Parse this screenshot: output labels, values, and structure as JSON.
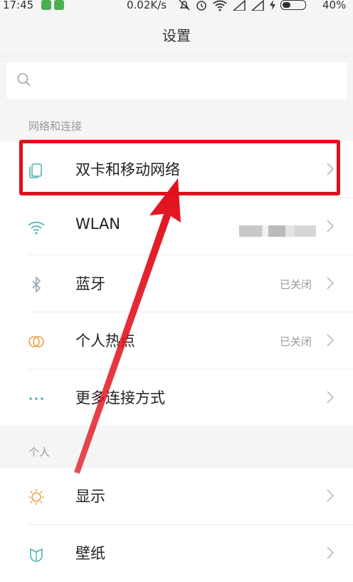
{
  "status_bar": {
    "time": "17:45",
    "speed": "0.02K/s",
    "battery": "40%",
    "battery_level": 0.4
  },
  "header": {
    "title": "设置"
  },
  "search": {
    "placeholder": ""
  },
  "network_section": {
    "heading": "网络和连接",
    "items": [
      {
        "label": "双卡和移动网络",
        "value": "",
        "icon": "sim-cards-icon"
      },
      {
        "label": "WLAN",
        "value": "",
        "icon": "wifi-icon"
      },
      {
        "label": "蓝牙",
        "value": "已关闭",
        "icon": "bluetooth-icon"
      },
      {
        "label": "个人热点",
        "value": "已关闭",
        "icon": "hotspot-icon"
      },
      {
        "label": "更多连接方式",
        "value": "",
        "icon": "more-dots-icon"
      }
    ]
  },
  "personal_section": {
    "heading": "个人",
    "items": [
      {
        "label": "显示",
        "value": "",
        "icon": "brightness-icon"
      },
      {
        "label": "壁纸",
        "value": "",
        "icon": "wallpaper-icon"
      }
    ]
  },
  "colors": {
    "highlight": "#e0101c",
    "icon_teal": "#4fb3b0",
    "icon_orange": "#e8a04a",
    "icon_gray": "#9aa6b0"
  }
}
